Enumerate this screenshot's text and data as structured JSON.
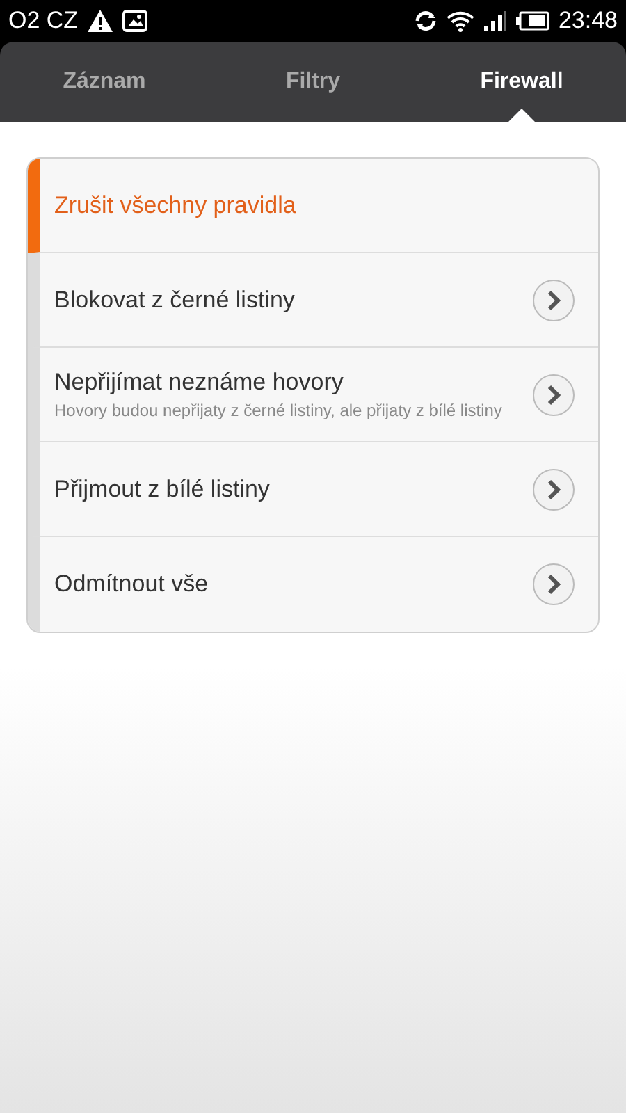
{
  "status_bar": {
    "carrier": "O2 CZ",
    "time": "23:48"
  },
  "tabs": [
    {
      "label": "Záznam",
      "selected": false
    },
    {
      "label": "Filtry",
      "selected": false
    },
    {
      "label": "Firewall",
      "selected": true
    }
  ],
  "items": [
    {
      "kind": "action",
      "title": "Zrušit všechny pravidla",
      "selected": true
    },
    {
      "kind": "option",
      "title": "Blokovat z černé listiny",
      "selected": false
    },
    {
      "kind": "option",
      "title": "Nepřijímat neznáme hovory",
      "subtitle": "Hovory budou nepřijaty z černé listiny, ale přijaty z bílé listiny",
      "selected": false
    },
    {
      "kind": "option",
      "title": "Přijmout z bílé listiny",
      "selected": false
    },
    {
      "kind": "option",
      "title": "Odmítnout vše",
      "selected": false
    }
  ]
}
